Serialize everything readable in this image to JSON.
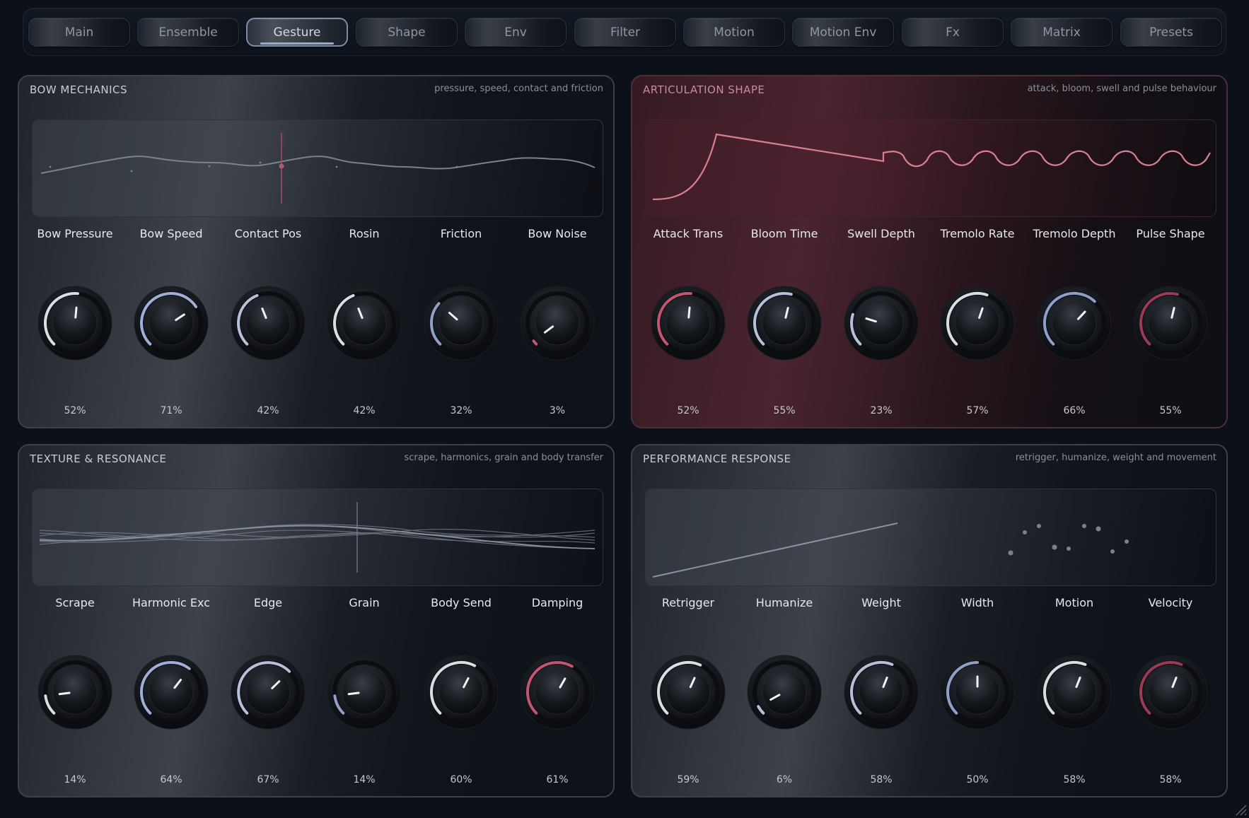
{
  "tabs": [
    {
      "label": "Main",
      "active": false
    },
    {
      "label": "Ensemble",
      "active": false
    },
    {
      "label": "Gesture",
      "active": true
    },
    {
      "label": "Shape",
      "active": false
    },
    {
      "label": "Env",
      "active": false
    },
    {
      "label": "Filter",
      "active": false
    },
    {
      "label": "Motion",
      "active": false
    },
    {
      "label": "Motion Env",
      "active": false
    },
    {
      "label": "Fx",
      "active": false
    },
    {
      "label": "Matrix",
      "active": false
    },
    {
      "label": "Presets",
      "active": false
    }
  ],
  "colors": {
    "accent_blue": "#9fb0d6",
    "accent_white": "#d9dde4",
    "accent_rose": "#c0566f",
    "articulation_curve": "#d98095"
  },
  "panels": {
    "bow_mechanics": {
      "title": "BOW MECHANICS",
      "subtitle": "pressure, speed, contact and friction",
      "visual": "bow-waveform",
      "knobs": [
        {
          "label": "Bow Pressure",
          "value": 0.52,
          "display": "52%",
          "arc_color": "#d9dde4"
        },
        {
          "label": "Bow Speed",
          "value": 0.71,
          "display": "71%",
          "arc_color": "#9fb0d6"
        },
        {
          "label": "Contact Pos",
          "value": 0.42,
          "display": "42%",
          "arc_color": "#b6c0d8"
        },
        {
          "label": "Rosin",
          "value": 0.42,
          "display": "42%",
          "arc_color": "#d9dde4"
        },
        {
          "label": "Friction",
          "value": 0.32,
          "display": "32%",
          "arc_color": "#8f9fc8"
        },
        {
          "label": "Bow Noise",
          "value": 0.03,
          "display": "3%",
          "arc_color": "#c0566f"
        }
      ]
    },
    "articulation_shape": {
      "title": "ARTICULATION SHAPE",
      "subtitle": "attack, bloom, swell and pulse behaviour",
      "visual": "articulation-envelope",
      "knobs": [
        {
          "label": "Attack Trans",
          "value": 0.52,
          "display": "52%",
          "arc_color": "#c0566f"
        },
        {
          "label": "Bloom Time",
          "value": 0.55,
          "display": "55%",
          "arc_color": "#b6c0d8"
        },
        {
          "label": "Swell Depth",
          "value": 0.23,
          "display": "23%",
          "arc_color": "#b6c0d8"
        },
        {
          "label": "Tremolo Rate",
          "value": 0.57,
          "display": "57%",
          "arc_color": "#d9dde4"
        },
        {
          "label": "Tremolo Depth",
          "value": 0.66,
          "display": "66%",
          "arc_color": "#8f9fc8"
        },
        {
          "label": "Pulse Shape",
          "value": 0.55,
          "display": "55%",
          "arc_color": "#9a3b55"
        }
      ]
    },
    "texture_resonance": {
      "title": "TEXTURE & RESONANCE",
      "subtitle": "scrape, harmonics, grain and body transfer",
      "visual": "texture-strands",
      "knobs": [
        {
          "label": "Scrape",
          "value": 0.14,
          "display": "14%",
          "arc_color": "#d9dde4"
        },
        {
          "label": "Harmonic Exc",
          "value": 0.64,
          "display": "64%",
          "arc_color": "#9fb0d6"
        },
        {
          "label": "Edge",
          "value": 0.67,
          "display": "67%",
          "arc_color": "#b6c0d8"
        },
        {
          "label": "Grain",
          "value": 0.14,
          "display": "14%",
          "arc_color": "#8f9fc8"
        },
        {
          "label": "Body Send",
          "value": 0.6,
          "display": "60%",
          "arc_color": "#d9dde4"
        },
        {
          "label": "Damping",
          "value": 0.61,
          "display": "61%",
          "arc_color": "#c0566f"
        }
      ]
    },
    "performance_response": {
      "title": "PERFORMANCE RESPONSE",
      "subtitle": "retrigger, humanize, weight and movement",
      "visual": "response-line-and-dots",
      "knobs": [
        {
          "label": "Retrigger",
          "value": 0.59,
          "display": "59%",
          "arc_color": "#d9dde4"
        },
        {
          "label": "Humanize",
          "value": 0.06,
          "display": "6%",
          "arc_color": "#b6c0d8"
        },
        {
          "label": "Weight",
          "value": 0.58,
          "display": "58%",
          "arc_color": "#b6c0d8"
        },
        {
          "label": "Width",
          "value": 0.5,
          "display": "50%",
          "arc_color": "#8f9fc8"
        },
        {
          "label": "Motion",
          "value": 0.58,
          "display": "58%",
          "arc_color": "#d9dde4"
        },
        {
          "label": "Velocity",
          "value": 0.58,
          "display": "58%",
          "arc_color": "#9a3b55"
        }
      ]
    }
  }
}
